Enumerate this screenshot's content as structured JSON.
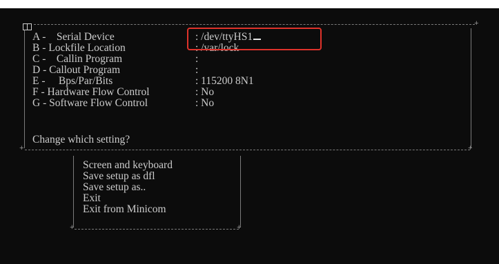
{
  "window": {
    "type": "minicom-terminal",
    "icon": "window-menu-icon"
  },
  "serial_port_setup": {
    "rows": [
      {
        "key": "A",
        "label": "A -    Serial Device",
        "value": ": /dev/ttyHS1",
        "highlighted": true
      },
      {
        "key": "B",
        "label": "B - Lockfile Location",
        "value": ": /var/lock"
      },
      {
        "key": "C",
        "label": "C -    Callin Program",
        "value": ":"
      },
      {
        "key": "D",
        "label": "D - Callout Program",
        "value": ":"
      },
      {
        "key": "E",
        "label": "E -     Bps/Par/Bits",
        "value": ": 115200 8N1"
      },
      {
        "key": "F",
        "label": "F - Hardware Flow Control",
        "value": ": No"
      },
      {
        "key": "G",
        "label": "G - Software Flow Control",
        "value": ": No"
      }
    ],
    "prompt": "Change which setting?"
  },
  "config_menu": {
    "items": [
      "Screen and keyboard",
      "Save setup as dfl",
      "Save setup as..",
      "Exit",
      "Exit from Minicom"
    ]
  },
  "colors": {
    "terminal_bg": "#0c0c0c",
    "terminal_text": "#cccccc",
    "highlight_border": "#e0332b"
  }
}
